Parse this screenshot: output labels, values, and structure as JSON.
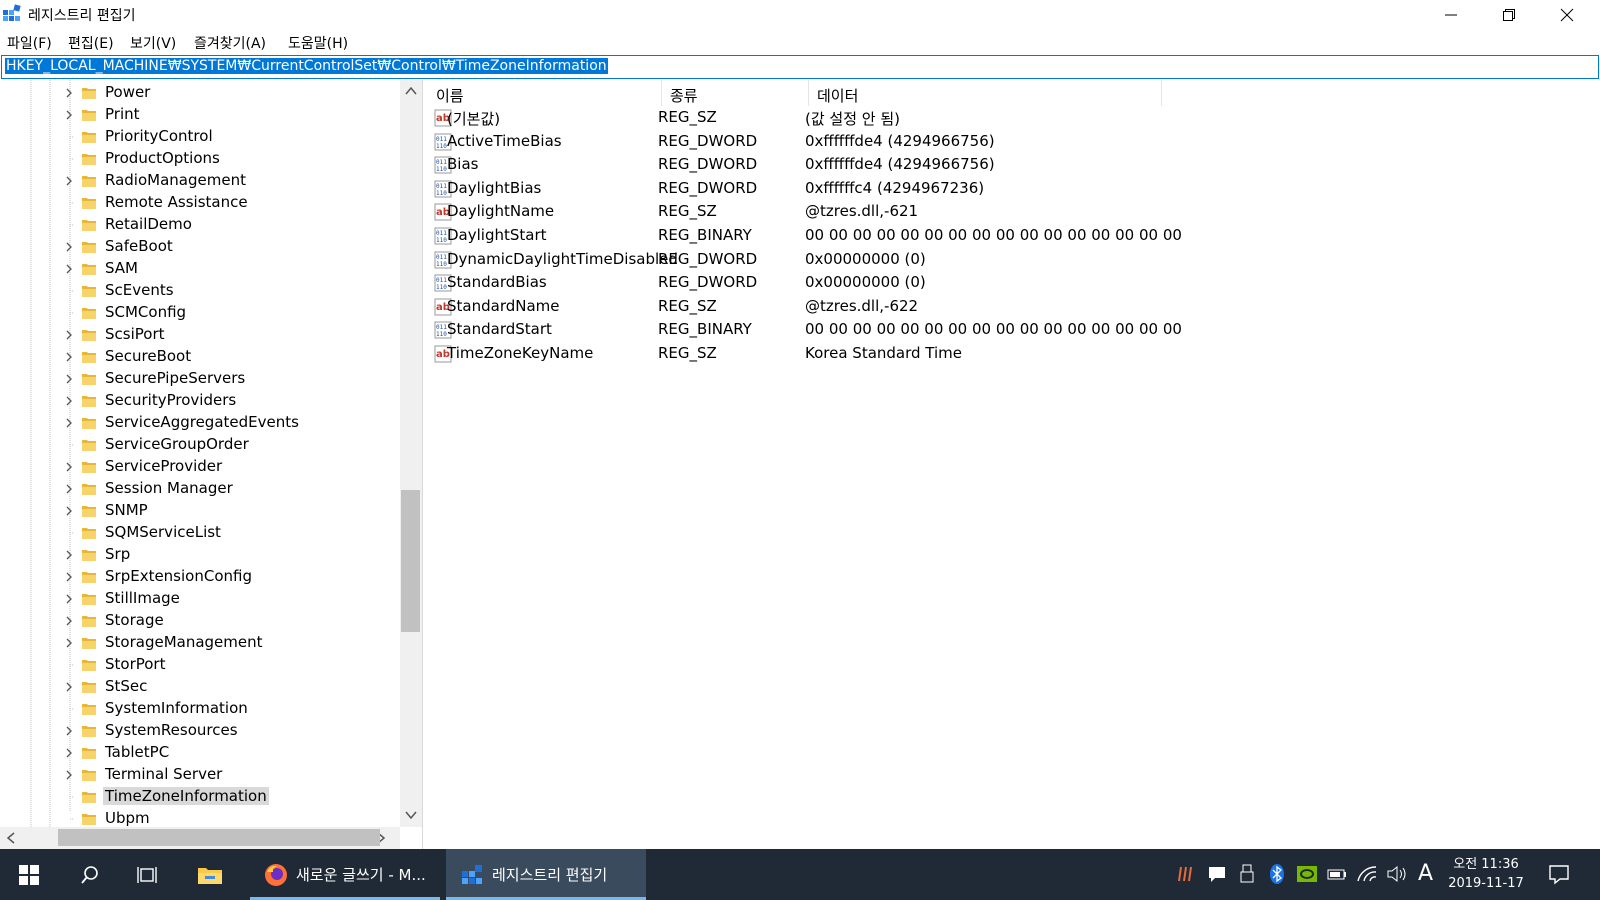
{
  "window": {
    "title": "레지스트리 편집기",
    "minimize_icon": "minimize-icon",
    "restore_icon": "restore-icon",
    "close_icon": "close-icon"
  },
  "menu": [
    {
      "label": "파일(F)"
    },
    {
      "label": "편집(E)"
    },
    {
      "label": "보기(V)"
    },
    {
      "label": "즐겨찾기(A)"
    },
    {
      "label": "도움말(H)"
    }
  ],
  "address": "HKEY_LOCAL_MACHINE₩SYSTEM₩CurrentControlSet₩Control₩TimeZoneInformation",
  "tree": [
    {
      "label": "Power",
      "expandable": true
    },
    {
      "label": "Print",
      "expandable": true
    },
    {
      "label": "PriorityControl",
      "expandable": false
    },
    {
      "label": "ProductOptions",
      "expandable": false
    },
    {
      "label": "RadioManagement",
      "expandable": true
    },
    {
      "label": "Remote Assistance",
      "expandable": false
    },
    {
      "label": "RetailDemo",
      "expandable": false
    },
    {
      "label": "SafeBoot",
      "expandable": true
    },
    {
      "label": "SAM",
      "expandable": true
    },
    {
      "label": "ScEvents",
      "expandable": false
    },
    {
      "label": "SCMConfig",
      "expandable": false
    },
    {
      "label": "ScsiPort",
      "expandable": true
    },
    {
      "label": "SecureBoot",
      "expandable": true
    },
    {
      "label": "SecurePipeServers",
      "expandable": true
    },
    {
      "label": "SecurityProviders",
      "expandable": true
    },
    {
      "label": "ServiceAggregatedEvents",
      "expandable": true
    },
    {
      "label": "ServiceGroupOrder",
      "expandable": false
    },
    {
      "label": "ServiceProvider",
      "expandable": true
    },
    {
      "label": "Session Manager",
      "expandable": true
    },
    {
      "label": "SNMP",
      "expandable": true
    },
    {
      "label": "SQMServiceList",
      "expandable": false
    },
    {
      "label": "Srp",
      "expandable": true
    },
    {
      "label": "SrpExtensionConfig",
      "expandable": true
    },
    {
      "label": "StillImage",
      "expandable": true
    },
    {
      "label": "Storage",
      "expandable": true
    },
    {
      "label": "StorageManagement",
      "expandable": true
    },
    {
      "label": "StorPort",
      "expandable": false
    },
    {
      "label": "StSec",
      "expandable": true
    },
    {
      "label": "SystemInformation",
      "expandable": false
    },
    {
      "label": "SystemResources",
      "expandable": true
    },
    {
      "label": "TabletPC",
      "expandable": true
    },
    {
      "label": "Terminal Server",
      "expandable": true
    },
    {
      "label": "TimeZoneInformation",
      "expandable": false,
      "selected": true
    },
    {
      "label": "Ubpm",
      "expandable": false
    }
  ],
  "columns": {
    "name": "이름",
    "type": "종류",
    "data": "데이터"
  },
  "values": [
    {
      "name": "(기본값)",
      "type": "REG_SZ",
      "data": "(값 설정 안 됨)",
      "icon": "string-value-icon"
    },
    {
      "name": "ActiveTimeBias",
      "type": "REG_DWORD",
      "data": "0xffffffde4 (4294966756)",
      "icon": "binary-value-icon"
    },
    {
      "name": "Bias",
      "type": "REG_DWORD",
      "data": "0xffffffde4 (4294966756)",
      "icon": "binary-value-icon"
    },
    {
      "name": "DaylightBias",
      "type": "REG_DWORD",
      "data": "0xffffffc4 (4294967236)",
      "icon": "binary-value-icon"
    },
    {
      "name": "DaylightName",
      "type": "REG_SZ",
      "data": "@tzres.dll,-621",
      "icon": "string-value-icon"
    },
    {
      "name": "DaylightStart",
      "type": "REG_BINARY",
      "data": "00 00 00 00 00 00 00 00 00 00 00 00 00 00 00 00",
      "icon": "binary-value-icon"
    },
    {
      "name": "DynamicDaylightTimeDisabled",
      "type": "REG_DWORD",
      "data": "0x00000000 (0)",
      "icon": "binary-value-icon"
    },
    {
      "name": "StandardBias",
      "type": "REG_DWORD",
      "data": "0x00000000 (0)",
      "icon": "binary-value-icon"
    },
    {
      "name": "StandardName",
      "type": "REG_SZ",
      "data": "@tzres.dll,-622",
      "icon": "string-value-icon"
    },
    {
      "name": "StandardStart",
      "type": "REG_BINARY",
      "data": "00 00 00 00 00 00 00 00 00 00 00 00 00 00 00 00",
      "icon": "binary-value-icon"
    },
    {
      "name": "TimeZoneKeyName",
      "type": "REG_SZ",
      "data": "Korea Standard Time",
      "icon": "string-value-icon"
    }
  ],
  "taskbar": {
    "apps": [
      {
        "label": "새로운 글쓰기 - M...",
        "icon": "firefox-icon",
        "active": false
      },
      {
        "label": "레지스트리 편집기",
        "icon": "regedit-icon",
        "active": true
      }
    ],
    "clock_time": "오전 11:36",
    "clock_date": "2019-11-17",
    "ime": "A",
    "colors": {
      "bg": "#1f2a36",
      "active": "#3a4b5e",
      "accent": "#76b9ed"
    }
  }
}
